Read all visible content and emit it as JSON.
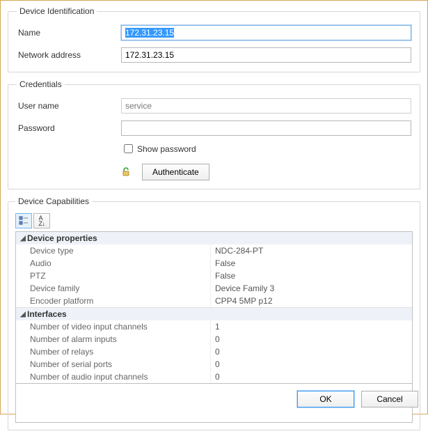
{
  "identification": {
    "legend": "Device Identification",
    "name_label": "Name",
    "name_value": "172.31.23.15",
    "addr_label": "Network address",
    "addr_value": "172.31.23.15"
  },
  "credentials": {
    "legend": "Credentials",
    "user_label": "User name",
    "user_value": "service",
    "pass_label": "Password",
    "pass_value": "",
    "show_pass_label": "Show password",
    "auth_button": "Authenticate"
  },
  "capabilities": {
    "legend": "Device Capabilities",
    "categories": [
      {
        "name": "Device properties",
        "rows": [
          {
            "name": "Device type",
            "value": "NDC-284-PT"
          },
          {
            "name": "Audio",
            "value": "False"
          },
          {
            "name": "PTZ",
            "value": "False"
          },
          {
            "name": "Device family",
            "value": "Device Family 3"
          },
          {
            "name": "Encoder platform",
            "value": "CPP4 5MP p12"
          }
        ]
      },
      {
        "name": "Interfaces",
        "rows": [
          {
            "name": "Number of video input channels",
            "value": "1"
          },
          {
            "name": "Number of alarm inputs",
            "value": "0"
          },
          {
            "name": "Number of relays",
            "value": "0"
          },
          {
            "name": "Number of serial ports",
            "value": "0"
          },
          {
            "name": "Number of audio input channels",
            "value": "0"
          }
        ]
      }
    ]
  },
  "footer": {
    "ok": "OK",
    "cancel": "Cancel"
  }
}
